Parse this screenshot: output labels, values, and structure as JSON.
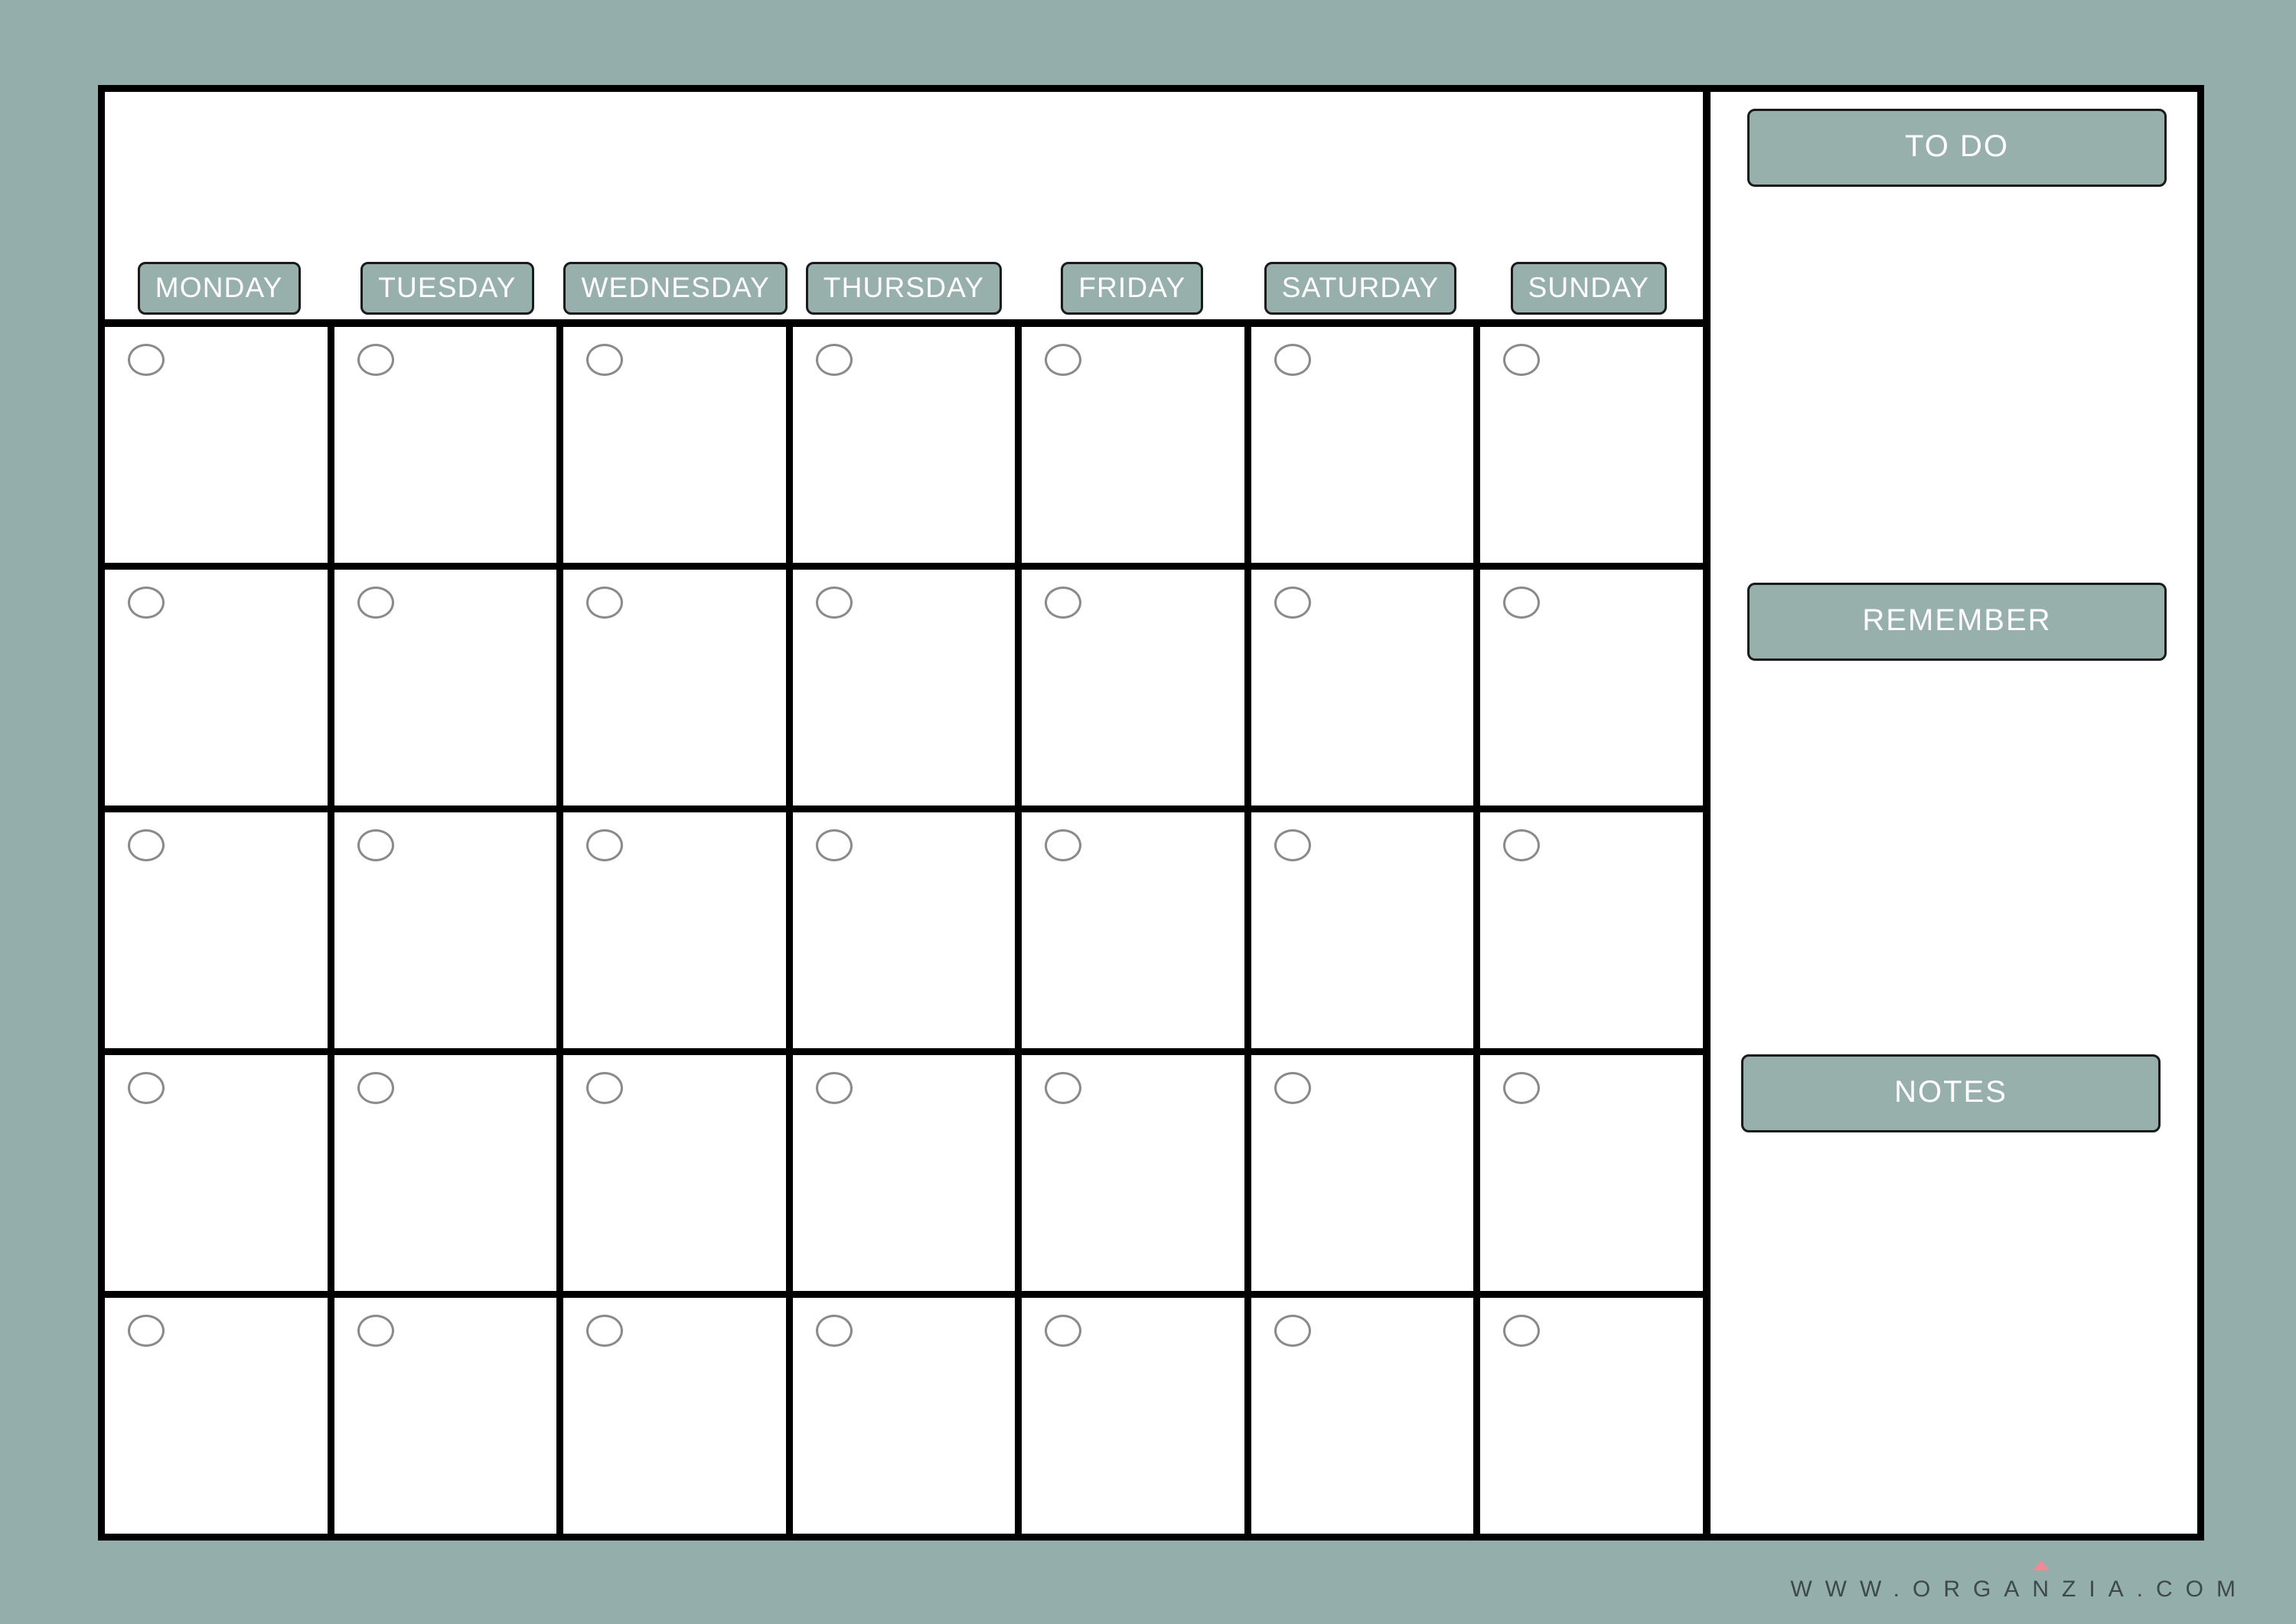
{
  "page": {
    "background_color": "#93aeab",
    "sheet_background": "#ffffff",
    "frame_color": "#000000",
    "accent_color": "#97b0ac",
    "circle_outline_color": "#8a8a8a",
    "watermark_accent_color": "#f08a95"
  },
  "calendar": {
    "month_title": "",
    "day_headers": [
      {
        "label": "MONDAY"
      },
      {
        "label": "TUESDAY"
      },
      {
        "label": "WEDNESDAY"
      },
      {
        "label": "THURSDAY"
      },
      {
        "label": "FRIDAY"
      },
      {
        "label": "SATURDAY"
      },
      {
        "label": "SUNDAY"
      }
    ],
    "rows": 5,
    "columns": 7,
    "cells": [
      [
        "",
        "",
        "",
        "",
        "",
        "",
        ""
      ],
      [
        "",
        "",
        "",
        "",
        "",
        "",
        ""
      ],
      [
        "",
        "",
        "",
        "",
        "",
        "",
        ""
      ],
      [
        "",
        "",
        "",
        "",
        "",
        "",
        ""
      ],
      [
        "",
        "",
        "",
        "",
        "",
        "",
        ""
      ]
    ]
  },
  "sidebar": {
    "sections": [
      {
        "title": "TO DO",
        "content": ""
      },
      {
        "title": "REMEMBER",
        "content": ""
      },
      {
        "title": "NOTES",
        "content": ""
      }
    ]
  },
  "footer": {
    "watermark": "WWW.ORGANZIA.COM"
  }
}
